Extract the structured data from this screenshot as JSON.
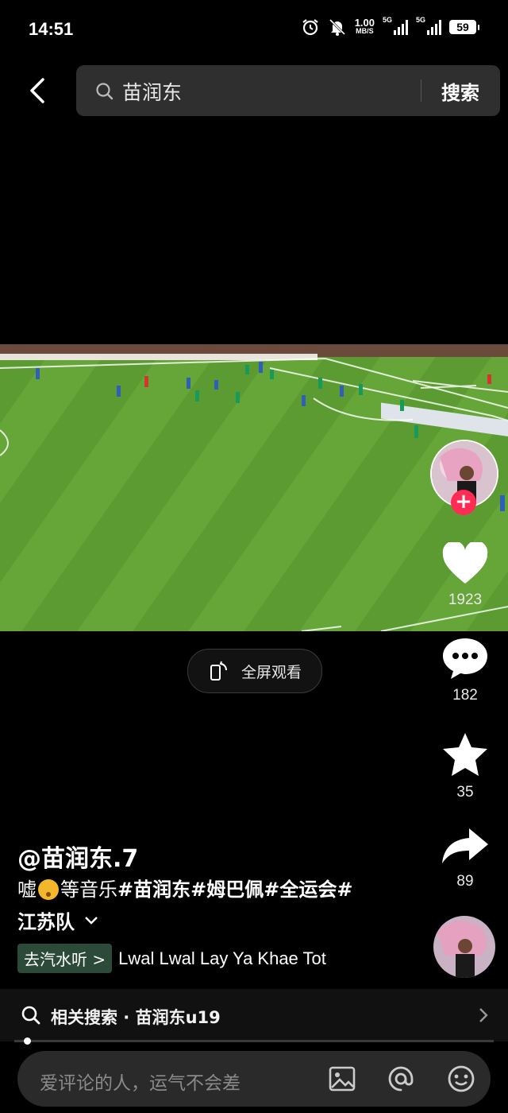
{
  "status": {
    "time": "14:51",
    "net_speed_value": "1.00",
    "net_speed_unit": "MB/S",
    "signal1": "5G",
    "signal2": "5G",
    "battery": "59"
  },
  "search": {
    "query": "苗润东",
    "button": "搜索"
  },
  "video": {
    "fullscreen_label": "全屏观看"
  },
  "rail": {
    "likes": "1923",
    "comments": "182",
    "favorites": "35",
    "shares": "89",
    "follow_symbol": "+"
  },
  "post": {
    "author": "@苗润东.7",
    "desc_prefix": "嘘",
    "desc_mid": "等音乐",
    "hashtags": "#苗润东#姆巴佩#全运会#",
    "desc_line2": "江苏队",
    "music_tag": "去汽水听 >",
    "music_title": "Lwal Lwal Lay Ya Khae Tot"
  },
  "related": {
    "text": "相关搜索 · 苗润东u19"
  },
  "comment": {
    "placeholder": "爱评论的人，运气不会差"
  },
  "colors": {
    "accent": "#fe2c55",
    "pitch": "#5a9a2f",
    "music_tag_bg": "#2c4a3a"
  }
}
